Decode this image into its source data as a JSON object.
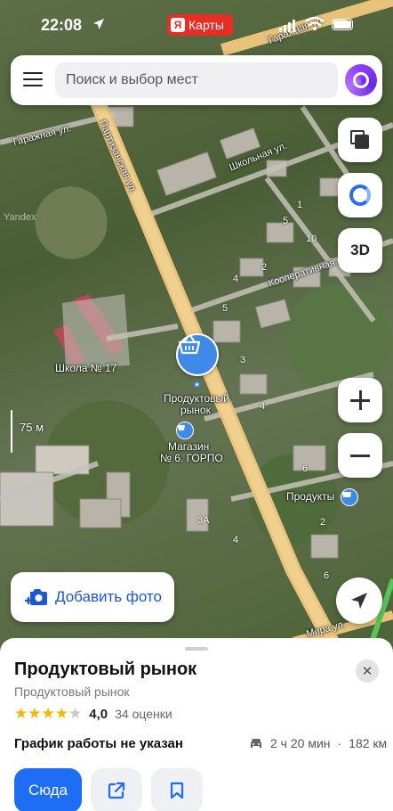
{
  "status_bar": {
    "time": "22:08",
    "app_badge": "Карты",
    "app_mark": "Я"
  },
  "search": {
    "placeholder": "Поиск и выбор мест"
  },
  "map_controls": {
    "threed_label": "3D",
    "scale_label": "75 м",
    "watermark": "Yandex"
  },
  "map_labels": {
    "streets": [
      "Гаражная ул.",
      "Гаражная ул.",
      "Партизанская ул.",
      "Школьная ул.",
      "Кооперативная ул.",
      "Мира ул."
    ],
    "school": "Школа № 17",
    "market_line1": "Продуктовый",
    "market_line2": "рынок",
    "shop_line1": "Магазин",
    "shop_line2": "№ 6. ГОРПО",
    "products": "Продукты",
    "house_numbers": [
      "4",
      "2",
      "1",
      "5",
      "10",
      "5",
      "4",
      "3",
      "6",
      "2",
      "6",
      "3А",
      "4"
    ]
  },
  "add_photo": {
    "label": "Добавить фото"
  },
  "place": {
    "title": "Продуктовый рынок",
    "category": "Продуктовый рынок",
    "rating": "4,0",
    "rating_stars_filled": 4,
    "rating_stars_total": 5,
    "rating_count": "34 оценки",
    "schedule": "График работы не указан",
    "route_time": "2 ч 20 мин",
    "route_separator": "·",
    "route_distance": "182 км"
  },
  "actions": {
    "route_button": "Сюда",
    "share_icon": "share-icon",
    "bookmark_icon": "bookmark-icon"
  },
  "colors": {
    "accent": "#1d6ef5",
    "road": "#e8c27a",
    "pin": "#3f8ae8",
    "star": "#f5b800",
    "badge": "#e62e24"
  }
}
